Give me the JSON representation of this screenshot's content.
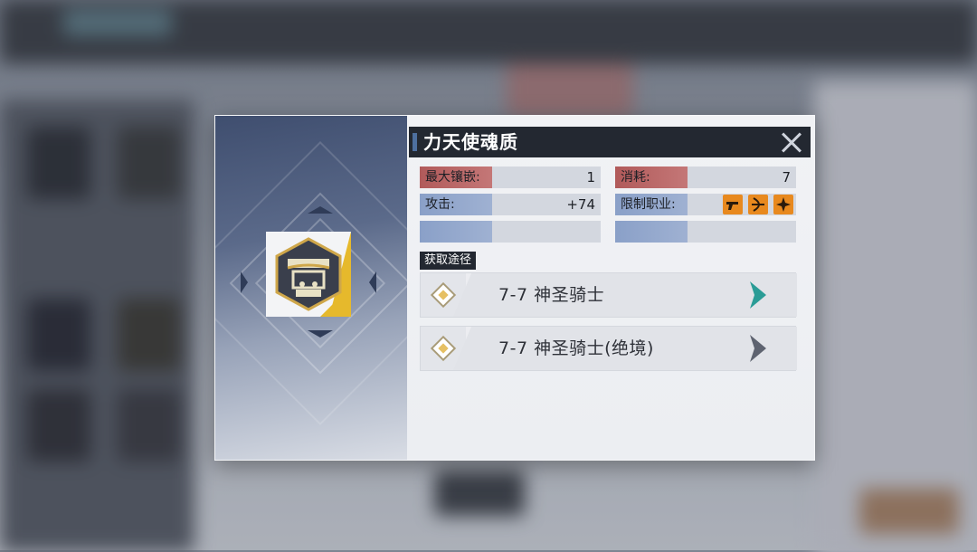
{
  "dialog": {
    "title": "力天使魂质",
    "close_icon": "close-icon",
    "item_icon": "soul-emblem-icon",
    "stats": {
      "max_inlay_label": "最大镶嵌:",
      "max_inlay_value": "1",
      "cost_label": "消耗:",
      "cost_value": "7",
      "attack_label": "攻击:",
      "attack_value": "+74",
      "class_limit_label": "限制职业:",
      "class_icons": [
        "gun-class-icon",
        "bow-class-icon",
        "shuriken-class-icon"
      ]
    },
    "sources_label": "获取途径",
    "sources": [
      {
        "label": "7-7 神圣骑士",
        "arrow_color": "#2a9c96",
        "icon": "diamond-icon"
      },
      {
        "label": "7-7 神圣骑士(绝境)",
        "arrow_color": "#5e6370",
        "icon": "diamond-icon"
      }
    ]
  },
  "colors": {
    "title_bar": "#232831",
    "label_red": "#b15a5a",
    "label_blue": "#8aa0c8",
    "class_icon": "#e8891e",
    "item_gold": "#e6b92c"
  }
}
